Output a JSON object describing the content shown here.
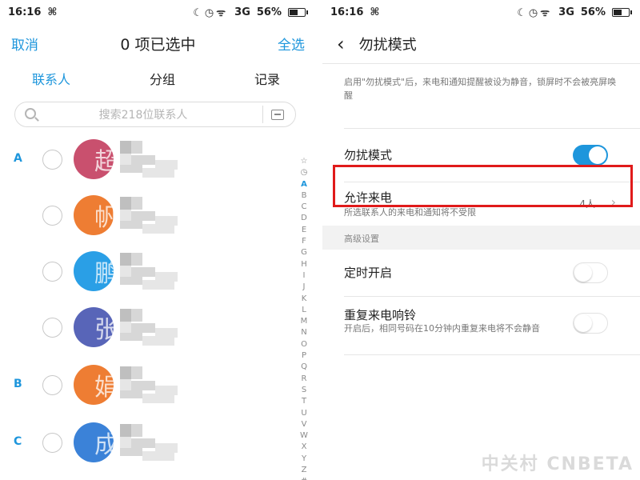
{
  "left_screen": {
    "status": {
      "time": "16:16",
      "network": "3G",
      "battery": "56%",
      "battery_level": 0.56
    },
    "header": {
      "cancel": "取消",
      "title": "0 项已选中",
      "select_all": "全选"
    },
    "tabs": [
      {
        "label": "联系人",
        "active": true
      },
      {
        "label": "分组",
        "active": false
      },
      {
        "label": "记录",
        "active": false
      }
    ],
    "search": {
      "placeholder": "搜索218位联系人"
    },
    "contacts": [
      {
        "section": "A",
        "avatar_char": "超",
        "avatar_color": "#c9506e"
      },
      {
        "section": "",
        "avatar_char": "帆",
        "avatar_color": "#ee7d33"
      },
      {
        "section": "",
        "avatar_char": "鹏",
        "avatar_color": "#2a9fe6"
      },
      {
        "section": "",
        "avatar_char": "张",
        "avatar_color": "#5865b8"
      },
      {
        "section": "B",
        "avatar_char": "娟",
        "avatar_color": "#ee7d33"
      },
      {
        "section": "C",
        "avatar_char": "成",
        "avatar_color": "#3b82d8"
      }
    ],
    "index_letters": [
      "☆",
      "◷",
      "A",
      "B",
      "C",
      "D",
      "E",
      "F",
      "G",
      "H",
      "I",
      "J",
      "K",
      "L",
      "M",
      "N",
      "O",
      "P",
      "Q",
      "R",
      "S",
      "T",
      "U",
      "V",
      "W",
      "X",
      "Y",
      "Z",
      "#"
    ]
  },
  "right_screen": {
    "status": {
      "time": "16:16",
      "network": "3G",
      "battery": "56%",
      "battery_level": 0.56
    },
    "header": {
      "title": "勿扰模式"
    },
    "description": "启用\"勿扰模式\"后，来电和通知提醒被设为静音，锁屏时不会被亮屏唤醒",
    "dnd": {
      "label": "勿扰模式",
      "enabled": true
    },
    "allow_calls": {
      "title": "允许来电",
      "subtitle": "所选联系人的来电和通知将不受限",
      "count": "4人"
    },
    "advanced_section": "高级设置",
    "scheduled": {
      "label": "定时开启",
      "enabled": false
    },
    "repeat_calls": {
      "title": "重复来电响铃",
      "subtitle": "开启后，相同号码在10分钟内重复来电将不会静音",
      "enabled": false
    },
    "accent_color": "#1e96dc",
    "highlight_color": "#e01a1a"
  },
  "watermark": "中关村 CNBETA"
}
